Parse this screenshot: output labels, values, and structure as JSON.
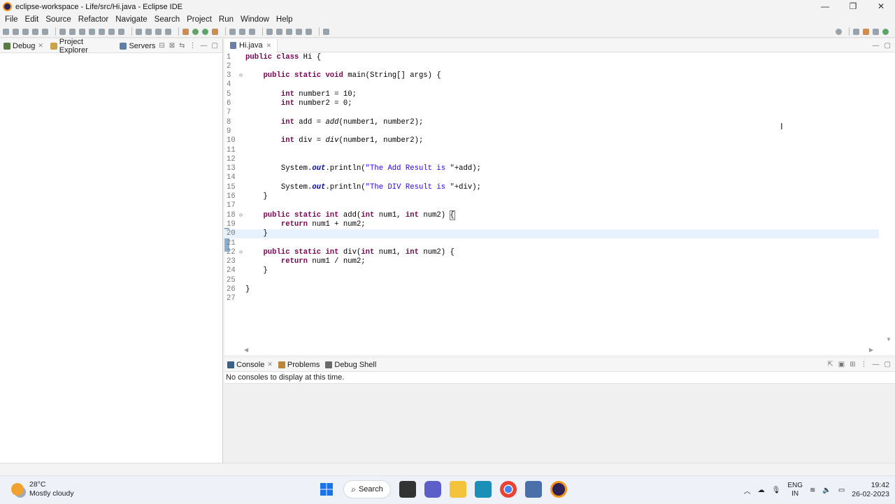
{
  "window": {
    "title": "eclipse-workspace - Life/src/Hi.java - Eclipse IDE",
    "controls": [
      "—",
      "❐",
      "✕"
    ]
  },
  "menu": [
    "File",
    "Edit",
    "Source",
    "Refactor",
    "Navigate",
    "Search",
    "Project",
    "Run",
    "Window",
    "Help"
  ],
  "left_panel": {
    "tabs": [
      {
        "label": "Debug",
        "closable": true
      },
      {
        "label": "Project Explorer",
        "closable": false
      },
      {
        "label": "Servers",
        "closable": false
      }
    ]
  },
  "editor": {
    "tab": "Hi.java",
    "current_line": 20,
    "lines": [
      {
        "n": "1",
        "html": "<span class='kw'>public class</span> Hi {"
      },
      {
        "n": "2",
        "html": ""
      },
      {
        "n": "3",
        "fold": true,
        "html": "    <span class='kw'>public static void</span> main(String[] args) {"
      },
      {
        "n": "4",
        "html": ""
      },
      {
        "n": "5",
        "html": "        <span class='kw'>int</span> number1 = 10;"
      },
      {
        "n": "6",
        "html": "        <span class='kw'>int</span> number2 = 0;"
      },
      {
        "n": "7",
        "html": ""
      },
      {
        "n": "8",
        "html": "        <span class='kw'>int</span> add = <span class='ital'>add</span>(number1, number2);"
      },
      {
        "n": "9",
        "html": ""
      },
      {
        "n": "10",
        "html": "        <span class='kw'>int</span> div = <span class='ital'>div</span>(number1, number2);"
      },
      {
        "n": "11",
        "html": ""
      },
      {
        "n": "12",
        "html": ""
      },
      {
        "n": "13",
        "html": "        System.<span class='fld'>out</span>.println(<span class='str'>\"The Add Result is \"</span>+add);"
      },
      {
        "n": "14",
        "html": ""
      },
      {
        "n": "15",
        "html": "        System.<span class='fld'>out</span>.println(<span class='str'>\"The DIV Result is \"</span>+div);"
      },
      {
        "n": "16",
        "html": "    }"
      },
      {
        "n": "17",
        "html": ""
      },
      {
        "n": "18",
        "fold": true,
        "html": "    <span class='kw'>public static int</span> add(<span class='kw'>int</span> num1, <span class='kw'>int</span> num2) <span style='outline:1px solid #777'>{</span>"
      },
      {
        "n": "19",
        "html": "        <span class='kw'>return</span> num1 + num2;"
      },
      {
        "n": "20",
        "html": "    }"
      },
      {
        "n": "21",
        "html": ""
      },
      {
        "n": "22",
        "fold": true,
        "html": "    <span class='kw'>public static int</span> div(<span class='kw'>int</span> num1, <span class='kw'>int</span> num2) {"
      },
      {
        "n": "23",
        "html": "        <span class='kw'>return</span> num1 / num2;"
      },
      {
        "n": "24",
        "html": "    }"
      },
      {
        "n": "25",
        "html": ""
      },
      {
        "n": "26",
        "html": "}"
      },
      {
        "n": "27",
        "html": ""
      }
    ]
  },
  "console": {
    "tabs": [
      {
        "label": "Console",
        "closable": true
      },
      {
        "label": "Problems",
        "closable": false
      },
      {
        "label": "Debug Shell",
        "closable": false
      }
    ],
    "message": "No consoles to display at this time."
  },
  "taskbar": {
    "weather_temp": "28°C",
    "weather_desc": "Mostly cloudy",
    "search_label": "Search",
    "lang_top": "ENG",
    "lang_bottom": "IN",
    "time": "19:42",
    "date": "26-02-2023"
  },
  "colors": {
    "keyword": "#7f0055",
    "string": "#2a00ff",
    "field": "#0000c0",
    "current_line": "#e8f2fe"
  }
}
